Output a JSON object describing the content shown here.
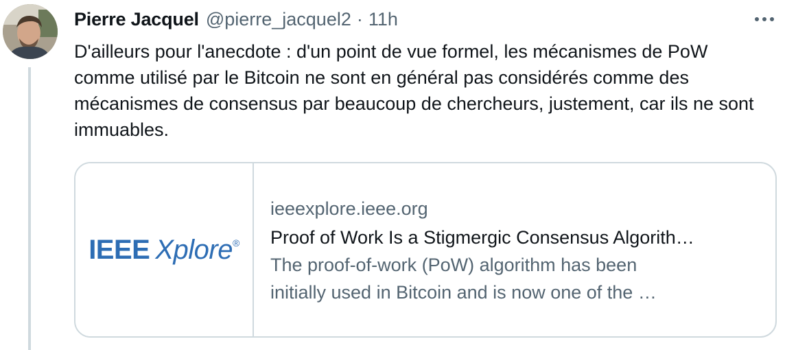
{
  "tweet": {
    "author_name": "Pierre Jacquel",
    "handle": "@pierre_jacquel2",
    "separator": "·",
    "time": "11h",
    "more_icon": "more-horizontal-icon",
    "text": "D'ailleurs pour l'anecdote : d'un point de vue formel, les mécanismes de PoW comme utilisé par le Bitcoin ne sont en général pas considérés comme des mécanismes de consensus par beaucoup de chercheurs, justement, car ils ne sont immuables."
  },
  "card": {
    "logo_main": "IEEE",
    "logo_sub": "Xplore",
    "logo_mark": "®",
    "domain": "ieeexplore.ieee.org",
    "title": "Proof of Work Is a Stigmergic Consensus Algorith…",
    "description_line1": "The proof-of-work (PoW) algorithm has been",
    "description_line2": "initially used in Bitcoin and is now one of the …"
  },
  "colors": {
    "text_primary": "#0f1419",
    "text_secondary": "#536471",
    "border": "#cfd9de",
    "ieee_blue": "#2d6db4"
  }
}
